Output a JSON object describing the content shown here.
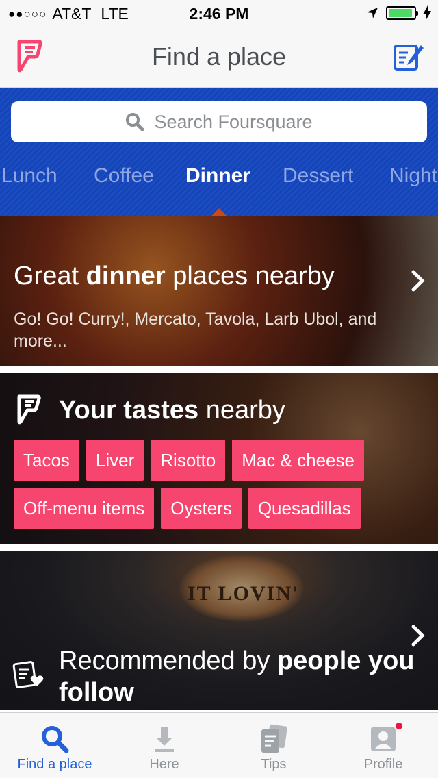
{
  "status_bar": {
    "signal": "●●○○○",
    "carrier": "AT&T",
    "network": "LTE",
    "time": "2:46 PM",
    "battery_level": 0.95
  },
  "nav": {
    "title": "Find a place",
    "left_icon": "foursquare-logo-icon",
    "right_icon": "compose-icon"
  },
  "search": {
    "placeholder": "Search Foursquare"
  },
  "categories": [
    "Lunch",
    "Coffee",
    "Dinner",
    "Dessert",
    "Nightlife"
  ],
  "selected_category": "Dinner",
  "card_dinner": {
    "title_pre": "Great ",
    "title_bold": "dinner",
    "title_post": " places nearby",
    "subtitle": "Go! Go! Curry!, Mercato, Tavola, Larb Ubol, and more..."
  },
  "card_tastes": {
    "title_bold": "Your tastes",
    "title_post": " nearby",
    "tastes": [
      "Tacos",
      "Liver",
      "Risotto",
      "Mac & cheese",
      "Off-menu items",
      "Oysters",
      "Quesadillas"
    ]
  },
  "card_follow": {
    "sign_text": "IT LOVIN'",
    "title_pre": "Recommended by ",
    "title_bold": "people you follow"
  },
  "tabs": [
    {
      "label": "Find a place",
      "icon": "search-icon",
      "active": true
    },
    {
      "label": "Here",
      "icon": "check-in-icon",
      "active": false
    },
    {
      "label": "Tips",
      "icon": "tips-icon",
      "active": false
    },
    {
      "label": "Profile",
      "icon": "profile-icon",
      "active": false,
      "badge": true
    }
  ],
  "colors": {
    "brand_pink": "#f6456e",
    "brand_blue": "#1544b8",
    "active_tab": "#2461d9"
  }
}
